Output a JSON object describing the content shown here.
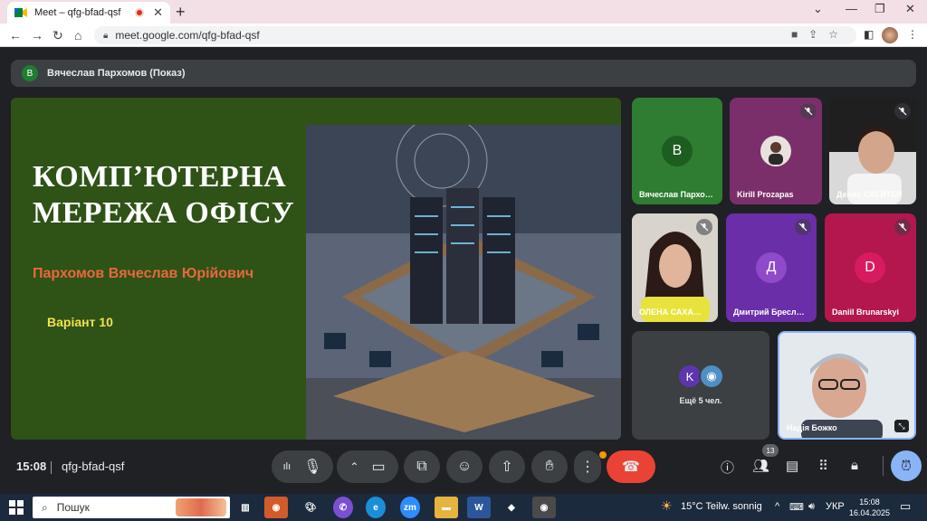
{
  "browser": {
    "tab_title": "Meet – qfg-bfad-qsf",
    "new_tab": "+",
    "url": "meet.google.com/qfg-bfad-qsf"
  },
  "meet": {
    "presenter_initial": "В",
    "presenter_label": "Вячеслав Пархомов (Показ)",
    "slide": {
      "title_line1": "КОМП’ЮТЕРНА",
      "title_line2": "МЕРЕЖА ОФІСУ",
      "author": "Пархомов Вячеслав Юрійович",
      "variant": "Варіант 10"
    },
    "participants": [
      {
        "name": "Вячеслав Пархо…",
        "initial": "В",
        "muted": false,
        "color": "#2e7d32"
      },
      {
        "name": "Kirill Prozapas",
        "initial": "",
        "muted": true,
        "color": "#7b2f6a"
      },
      {
        "name": "Денис СКЕЙТЕР",
        "initial": "",
        "muted": true,
        "color": "#1f1f1f"
      },
      {
        "name": "ОЛЕНА САХА…",
        "initial": "",
        "muted": true,
        "color": "#d8d4cc"
      },
      {
        "name": "Дмитрий Бресл…",
        "initial": "Д",
        "muted": true,
        "color": "#6a2ea8"
      },
      {
        "name": "Daniil Brunarskyi",
        "initial": "D",
        "muted": true,
        "color": "#b3174e"
      },
      {
        "name": "Надія Божко",
        "initial": "",
        "muted": false,
        "color": "#cfd6dc"
      }
    ],
    "more": {
      "initial": "K",
      "label": "Ещё 5 чел."
    },
    "time": "15:08",
    "meeting_code": "qfg-bfad-qsf",
    "people_count": "13"
  },
  "taskbar": {
    "search_placeholder": "Пошук",
    "weather": "15°C  Teilw. sonnig",
    "lang": "УКР",
    "time": "15:08",
    "date": "16.04.2025"
  },
  "colors": {
    "meet_bg": "#202124",
    "end_call": "#ea4335",
    "slide_bg": "#2f5217",
    "taskbar": "#1c2a3d"
  }
}
